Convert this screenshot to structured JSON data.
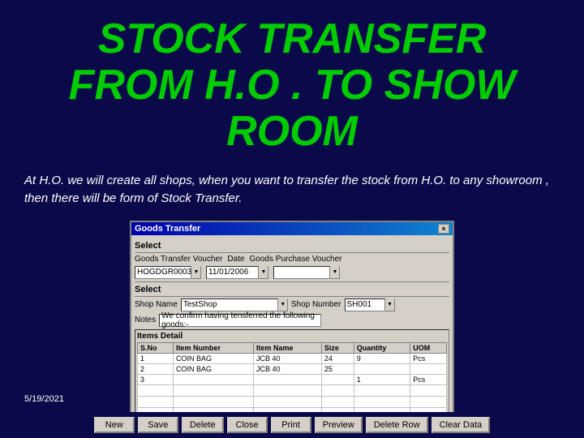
{
  "title": {
    "line1": "STOCK TRANSFER",
    "line2": "FROM H.O . TO SHOW ROOM"
  },
  "subtitle": "At H.O. we will create all shops, when you want to transfer the stock from H.O. to any showroom , then there will be form of Stock Transfer.",
  "dialog": {
    "title": "Goods Transfer",
    "close_btn": "×",
    "sections": {
      "select_label": "Select",
      "voucher_label": "Goods Transfer Voucher",
      "voucher_value": "HOGDGR0003",
      "date_label": "Date",
      "date_value": "11/01/2006",
      "purchase_label": "Goods Purchase Voucher",
      "select2_label": "Select",
      "shop_name_label": "Shop Name",
      "shop_name_value": "TestShop",
      "shop_number_label": "Shop Number",
      "shop_number_value": "SH001",
      "notes_label": "Notes",
      "notes_value": "We confirm having tensferred the following goods:-",
      "items_label": "Items Detail"
    },
    "table": {
      "headers": [
        "S.No",
        "Item Number",
        "Item Name",
        "Size",
        "Quantity",
        "UOM"
      ],
      "rows": [
        [
          "1",
          "COIN BAG",
          "JCB 40",
          "24",
          "9",
          "Pcs"
        ],
        [
          "2",
          "COIN BAG",
          "JCB 40",
          "25",
          "",
          ""
        ],
        [
          "3",
          "",
          "",
          "",
          "1",
          "Pcs"
        ]
      ]
    },
    "buttons": [
      "New",
      "Save",
      "Delete",
      "Close",
      "Print",
      "Preview",
      "Delete Row",
      "Clear Data"
    ]
  },
  "footer": {
    "date": "5/19/2021"
  },
  "bottom_buttons": [
    "New",
    "Save",
    "Delete",
    "Close",
    "Print",
    "Preview",
    "Delete Row",
    "Clear Data"
  ]
}
